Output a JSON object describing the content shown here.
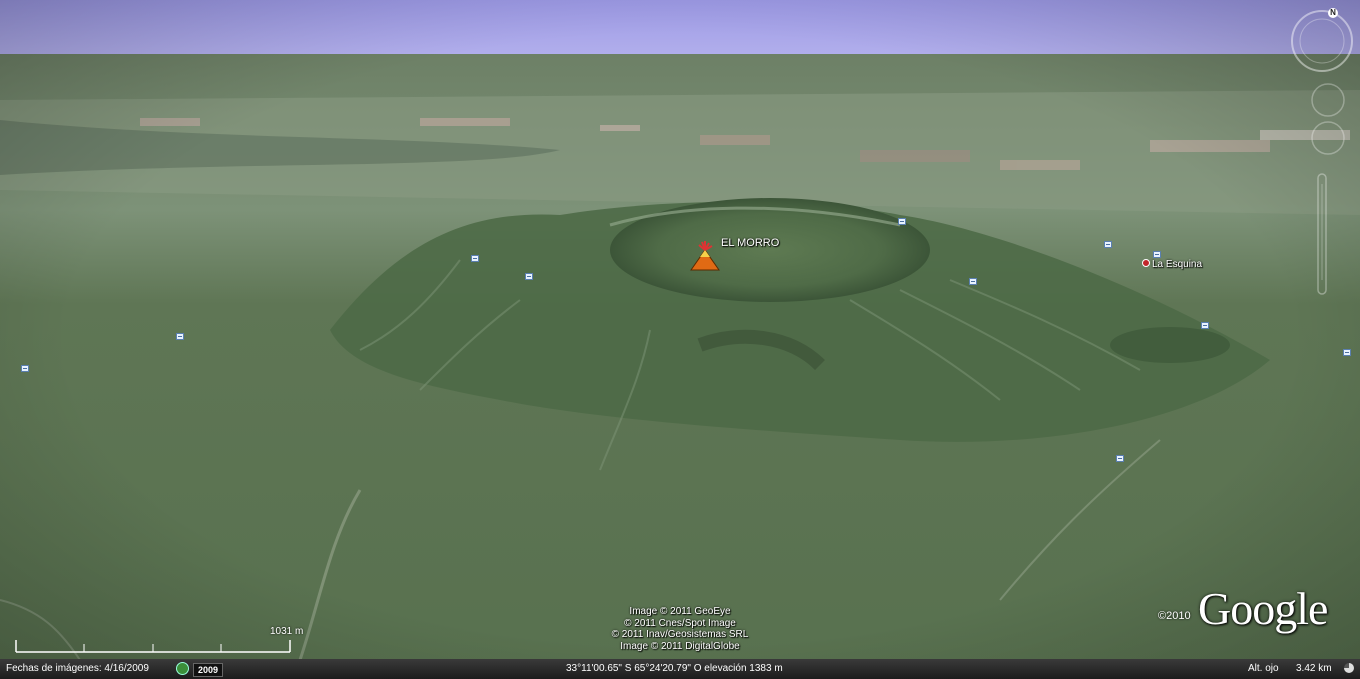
{
  "places": {
    "volcano_label": "EL MORRO",
    "town_label": "La Esquina"
  },
  "credits": {
    "lines": [
      "Image © 2011 GeoEye",
      "© 2011 Cnes/Spot Image",
      "© 2011 Inav/Geosistemas SRL",
      "Image © 2011 DigitalGlobe"
    ]
  },
  "branding": {
    "copyright_year": "©2010",
    "logo_text": "Google"
  },
  "scale": {
    "label": "1031 m"
  },
  "compass": {
    "north_label": "N"
  },
  "statusbar": {
    "imagery_date": "Fechas de imágenes: 4/16/2009",
    "history_year": "2009",
    "coordinates": "33°11'00.65\" S   65°24'20.79\" O  elevación 1383 m",
    "eye_alt_label": "Alt. ojo",
    "eye_alt_value": "3.42 km"
  },
  "colors": {
    "sky": "#a9a6e8",
    "terrain": "#5f7a55",
    "statusbar": "#2a2a2a"
  }
}
